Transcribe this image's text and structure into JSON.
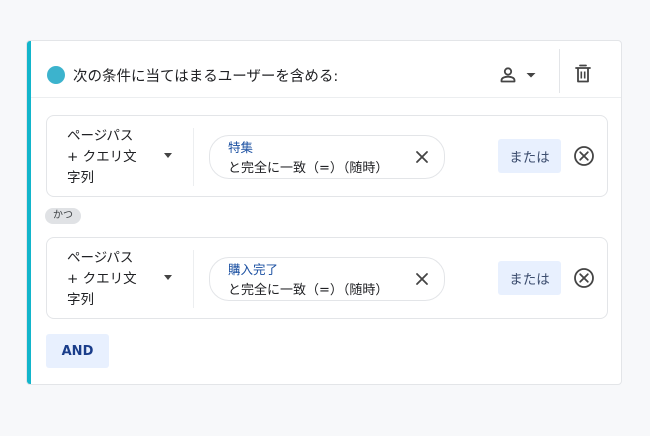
{
  "header": {
    "title": "次の条件に当てはまるユーザーを含める:",
    "dot_color": "#3cb3cd",
    "scope_icon": "person-icon",
    "delete_icon": "trash-icon"
  },
  "conditions": [
    {
      "dimension_lines": [
        "ページパス",
        "+ クエリ文",
        "字列"
      ],
      "value": "特集",
      "match": "と完全に一致（=）（随時）",
      "or_label": "または"
    },
    {
      "dimension_lines": [
        "ページパス",
        "+ クエリ文",
        "字列"
      ],
      "value": "購入完了",
      "match": "と完全に一致（=）（随時）",
      "or_label": "または"
    }
  ],
  "connector_label": "かつ",
  "and_button_label": "AND",
  "colors": {
    "accent": "#12b5cb",
    "button_bg": "#e8f0fe",
    "value_text": "#1a4fa1"
  }
}
